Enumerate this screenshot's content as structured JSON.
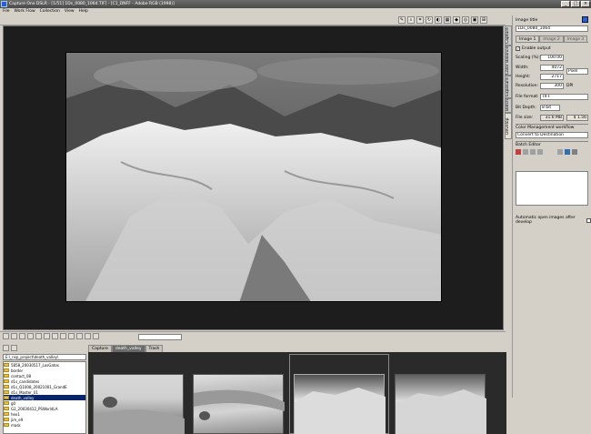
{
  "window": {
    "title": "Capture One DSLR - [1/51] 1Ds_0080_1064.TIF] - [C1_DNFF - Adobe RGB (1998)]"
  },
  "menu": [
    "File",
    "Work Flow",
    "Collection",
    "View",
    "Help"
  ],
  "right_panel": {
    "image_title_label": "Image title",
    "image_title_value": "1Ds_0080_1064",
    "tabs": [
      "Image 1",
      "Image 2",
      "Image 3"
    ],
    "enable_output_label": "Enable output",
    "scaling_label": "Scaling (%):",
    "scaling_value": "100.00",
    "width_label": "Width:",
    "width_value": "4072",
    "height_label": "Height:",
    "height_value": "2717",
    "unit_value": "Pixel",
    "resolution_label": "Resolution:",
    "resolution_value": "300",
    "resolution_unit": "DPI",
    "file_format_label": "File format:",
    "file_format_value": "TIFF",
    "bit_depth_label": "Bit Depth:",
    "bit_depth_value": "8 bit",
    "file_size_label": "File size:",
    "file_size_value": "31.6 MB",
    "file_size_value2": "$ 1.56",
    "color_mgmt_label": "Color Management workflow",
    "color_mgmt_value": "Convert to Destination",
    "batch_editor_label": "Batch Editor",
    "auto_open_label": "Automatic open images after develop"
  },
  "vertical_tabs": [
    "Develop",
    "Batch",
    "Exposure",
    "Color Balance",
    "Capture"
  ],
  "browser": {
    "folder_path": "E:\\_nsp_project\\death_valley\\",
    "folders": [
      "5858_20030517_LosGatos",
      "border",
      "contact_08",
      "d1s_candidates",
      "d1s_Q1008_20021001_GrandE",
      "d1s_Master_01",
      "death_valley",
      "g0",
      "G2_20030412_PSWorldLA",
      "hex1",
      "jim_e9",
      "mask"
    ],
    "capture_tabs": [
      "Capture",
      "death_valley",
      "Trash"
    ]
  },
  "colors": {
    "viewer_bg": "#1d1d1d",
    "panel_bg": "#d4d0c8",
    "titlebar": "#5a5a5a"
  }
}
